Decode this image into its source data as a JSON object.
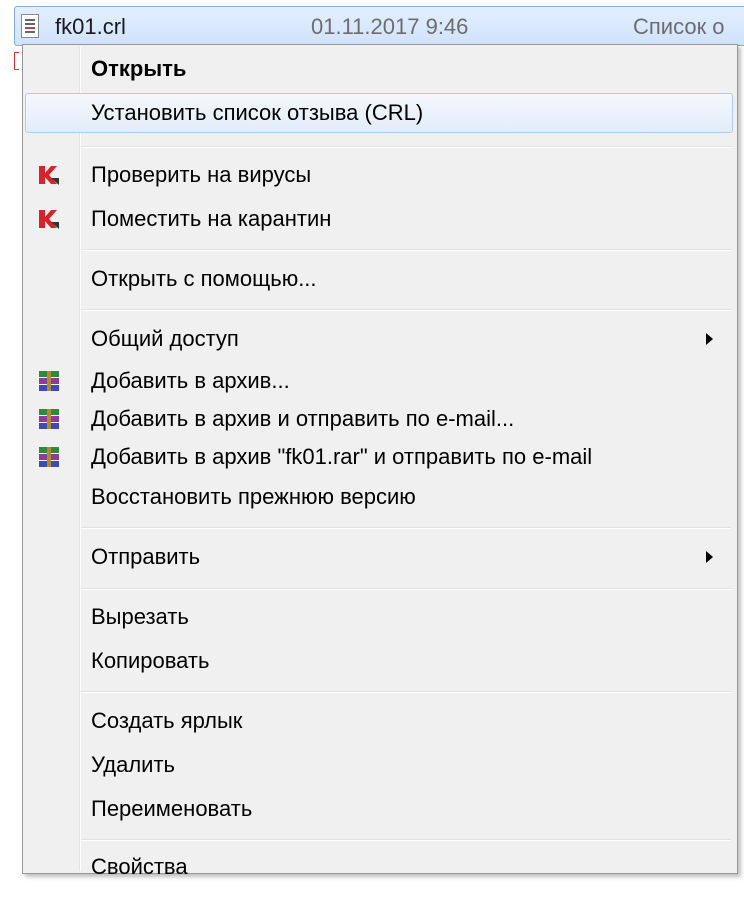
{
  "explorer_row": {
    "file_name": "fk01.crl",
    "date_modified": "01.11.2017 9:46",
    "type_partial": "Список о"
  },
  "menu": {
    "open": "Открыть",
    "install_crl": "Установить список отзыва (CRL)",
    "scan_virus": "Проверить на вирусы",
    "quarantine": "Поместить на карантин",
    "open_with": "Открыть с помощью...",
    "share": "Общий доступ",
    "add_archive": "Добавить в архив...",
    "add_archive_email": "Добавить в архив и отправить по e-mail...",
    "add_rar_email": "Добавить в архив \"fk01.rar\" и отправить по e-mail",
    "restore_version": "Восстановить прежнюю версию",
    "send_to": "Отправить",
    "cut": "Вырезать",
    "copy": "Копировать",
    "create_shortcut": "Создать ярлык",
    "delete": "Удалить",
    "rename": "Переименовать",
    "properties": "Свойства"
  },
  "icons": {
    "file": "crl-file-icon",
    "kaspersky": "kaspersky-icon",
    "winrar": "winrar-icon",
    "submenu": "chevron-right-icon"
  },
  "colors": {
    "menu_bg": "#f0f0f0",
    "hover_border": "#aeccf1",
    "selection_bg": "#cfe2fb"
  }
}
